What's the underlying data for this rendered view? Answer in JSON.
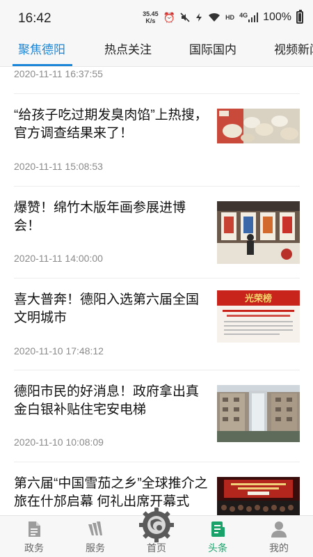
{
  "status_bar": {
    "time": "16:42",
    "net_speed_value": "35.45",
    "net_speed_unit": "K/s",
    "signal_label": "HD",
    "network_type": "4G",
    "battery": "100%"
  },
  "tabs": [
    {
      "label": "聚焦德阳",
      "active": true
    },
    {
      "label": "热点关注",
      "active": false
    },
    {
      "label": "国际国内",
      "active": false
    },
    {
      "label": "视频新闻",
      "active": false
    }
  ],
  "feed": {
    "first_date": "2020-11-11 16:37:55",
    "items": [
      {
        "title": "“给孩子吃过期发臭肉馅”上热搜，官方调查结果来了！",
        "date": "2020-11-11 15:08:53",
        "thumb_icon": "dumplings-photo"
      },
      {
        "title": "爆赞！绵竹木版年画参展进博会！",
        "date": "2020-11-11 14:00:00",
        "thumb_icon": "exhibition-photo"
      },
      {
        "title": "喜大普奔！德阳入选第六届全国文明城市",
        "date": "2020-11-10 17:48:12",
        "thumb_icon": "honor-list-photo",
        "thumb_text": "光荣榜"
      },
      {
        "title": "德阳市民的好消息！政府拿出真金白银补贴住宅安电梯",
        "date": "2020-11-10 10:08:09",
        "thumb_icon": "building-elevator-photo"
      },
      {
        "title": "第六届“中国雪茄之乡”全球推介之旅在什邡启幕 何礼出席开幕式",
        "date": "",
        "thumb_icon": "stage-event-photo"
      }
    ]
  },
  "bottom_nav": [
    {
      "label": "政务",
      "icon": "document-icon",
      "active": false
    },
    {
      "label": "服务",
      "icon": "service-icon",
      "active": false
    },
    {
      "label": "首页",
      "icon": "home-gear-icon",
      "active": false
    },
    {
      "label": "头条",
      "icon": "headlines-icon",
      "active": true
    },
    {
      "label": "我的",
      "icon": "person-icon",
      "active": false
    }
  ],
  "colors": {
    "accent_blue": "#1b86d7",
    "accent_green": "#1aa26b",
    "date_gray": "#8a8a8a"
  }
}
